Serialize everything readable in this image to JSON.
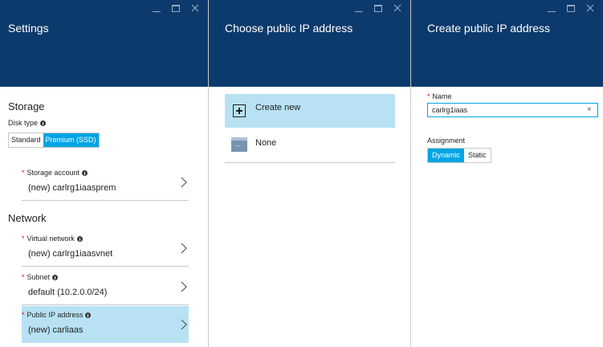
{
  "blades": {
    "settings": {
      "title": "Settings",
      "storage": {
        "heading": "Storage",
        "disk_type": {
          "label": "Disk type",
          "options": [
            "Standard",
            "Premium (SSD)"
          ],
          "selected": "Premium (SSD)"
        },
        "storage_account": {
          "label": "Storage account",
          "value": "(new) carlrg1iaasprem"
        }
      },
      "network": {
        "heading": "Network",
        "virtual_network": {
          "label": "Virtual network",
          "value": "(new) carlrg1iaasvnet"
        },
        "subnet": {
          "label": "Subnet",
          "value": "default (10.2.0.0/24)"
        },
        "public_ip": {
          "label": "Public IP address",
          "value": "(new) carliaas"
        }
      }
    },
    "choose_ip": {
      "title": "Choose public IP address",
      "options": {
        "create_new": "Create new",
        "none": "None"
      }
    },
    "create_ip": {
      "title": "Create public IP address",
      "name": {
        "label": "Name",
        "value": "carlrg1iaas"
      },
      "assignment": {
        "label": "Assignment",
        "options": [
          "Dynamic",
          "Static"
        ],
        "selected": "Dynamic"
      }
    }
  },
  "icons": {
    "required_marker": "*",
    "clear_glyph": "×",
    "info": "info-icon",
    "chevron": "chevron-right-icon",
    "add": "plus-icon",
    "none": "empty-resource-icon"
  },
  "colors": {
    "header_bg": "#0d3a6d",
    "accent": "#00a4e4",
    "selected_bg": "#b8e2f4",
    "required": "#e00b1c"
  }
}
